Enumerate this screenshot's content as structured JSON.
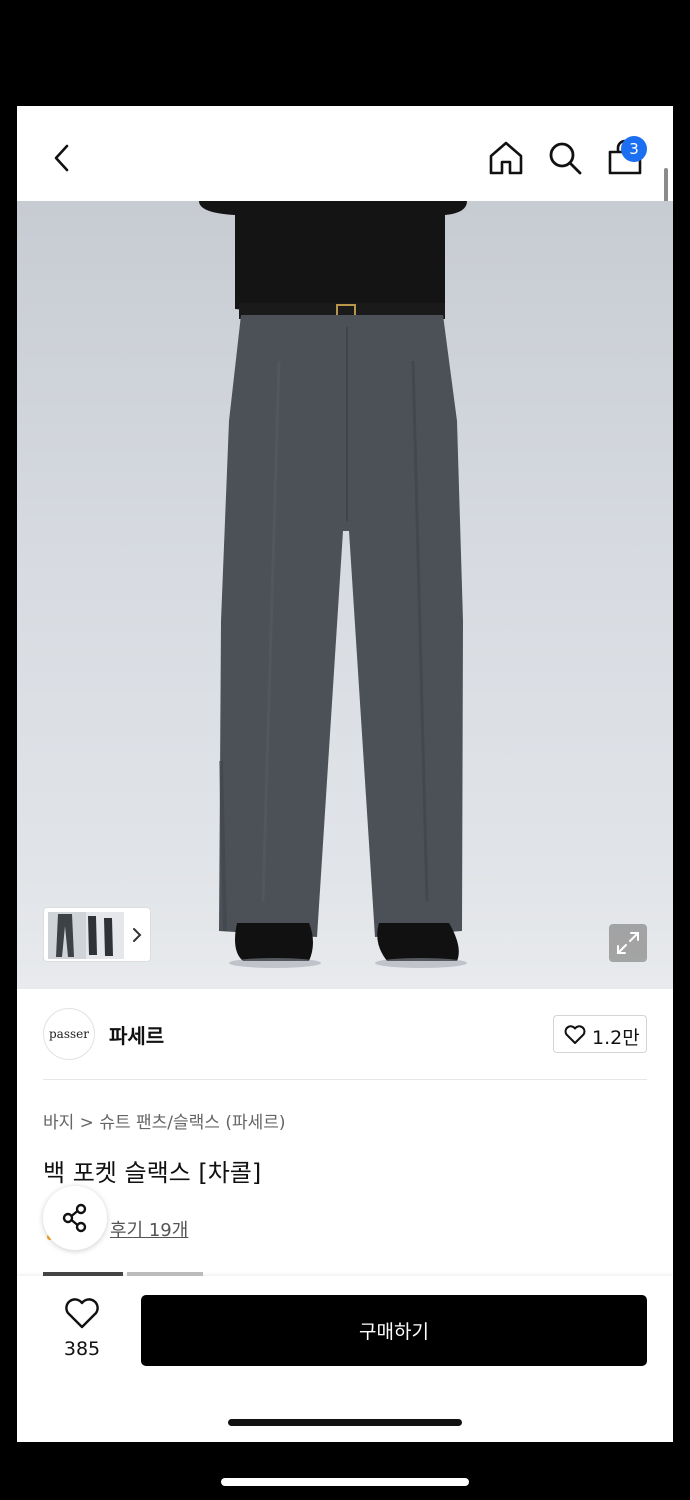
{
  "header": {
    "back_icon": "chevron-left-icon",
    "home_icon": "home-icon",
    "search_icon": "search-icon",
    "cart_icon": "shopping-bag-icon",
    "cart_badge": "3"
  },
  "gallery": {
    "thumbnail_more_icon": "chevron-right-icon",
    "expand_icon": "expand-icon"
  },
  "brand": {
    "logo_text": "passer",
    "name": "파세르",
    "likes": "1.2만"
  },
  "product": {
    "breadcrumb": "바지 > 슈트 팬츠/슬랙스 (파세르)",
    "title": "백 포켓 슬랙스 [차콜]",
    "reviews": "후기 19개"
  },
  "bottom": {
    "wish_count": "385",
    "buy_label": "구매하기"
  },
  "colors": {
    "accent": "#1d6ff2",
    "buy_button": "#000000"
  }
}
